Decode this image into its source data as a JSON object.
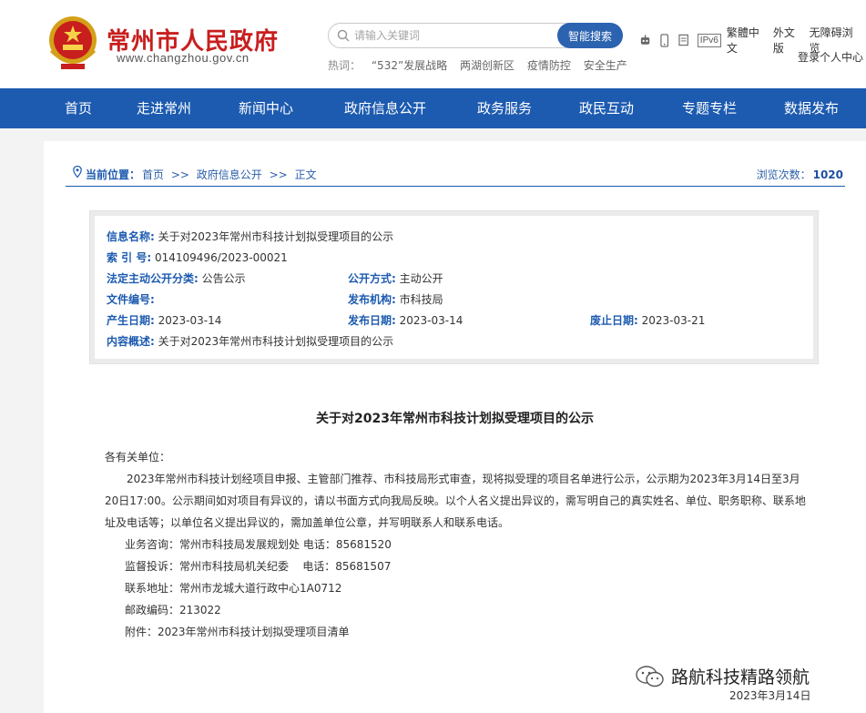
{
  "header": {
    "site_name": "常州市人民政府",
    "site_url": "www.changzhou.gov.cn",
    "search": {
      "placeholder": "请输入关键词",
      "button": "智能搜索"
    },
    "hot_label": "热词：",
    "hot_words": [
      "“532”发展战略",
      "两湖创新区",
      "疫情防控",
      "安全生产"
    ],
    "tools": {
      "ipv6": "IPv6",
      "traditional": "繁體中文",
      "foreign": "外文版",
      "accessible": "无障碍浏览",
      "login": "登录个人中心"
    },
    "icons": {
      "robot": "robot-icon",
      "mobile": "mobile-icon",
      "copy": "document-icon"
    }
  },
  "nav": [
    "首页",
    "走进常州",
    "新闻中心",
    "政府信息公开",
    "政务服务",
    "政民互动",
    "专题专栏",
    "数据发布"
  ],
  "breadcrumb": {
    "label": "当前位置：",
    "items": [
      "首页",
      ">>",
      "政府信息公开",
      ">>",
      "正文"
    ],
    "views_label": "浏览次数：",
    "views": "1020"
  },
  "meta": {
    "info_name_k": "信息名称:",
    "info_name_v": "关于对2023年常州市科技计划拟受理项目的公示",
    "index_k": "索 引 号:",
    "index_v": "014109496/2023-00021",
    "category_k": "法定主动公开分类:",
    "category_v": "公告公示",
    "method_k": "公开方式:",
    "method_v": "主动公开",
    "docno_k": "文件编号:",
    "docno_v": "",
    "publisher_k": "发布机构:",
    "publisher_v": "市科技局",
    "created_k": "产生日期:",
    "created_v": "2023-03-14",
    "released_k": "发布日期:",
    "released_v": "2023-03-14",
    "expire_k": "废止日期:",
    "expire_v": "2023-03-21",
    "summary_k": "内容概述:",
    "summary_v": "关于对2023年常州市科技计划拟受理项目的公示"
  },
  "article": {
    "title": "关于对2023年常州市科技计划拟受理项目的公示",
    "greeting": "各有关单位：",
    "para_line1": "2023年常州市科技计划经项目申报、主管部门推荐、市科技局形式审查，现将拟受理的项目名单进行公示，公示期为2023年3月14日至3月",
    "para_line2": "20日17:00。公示期间如对项目有异议的，请以书面方式向我局反映。以个人名义提出异议的，需写明自己的真实姓名、单位、职务职称、联系地",
    "para_line3": "址及电话等；以单位名义提出异议的，需加盖单位公章，并写明联系人和联系电话。",
    "consult": "业务咨询：常州市科技局发展规划处 电话：85681520",
    "supervise": "监督投诉：常州市科技局机关纪委    电话：85681507",
    "address": "联系地址：常州市龙城大道行政中心1A0712",
    "postcode": "邮政编码：213022",
    "attachment": "附件：2023年常州市科技计划拟受理项目清单",
    "date": "2023年3月14日"
  },
  "watermark": "路航科技精路领航",
  "colors": {
    "brand_red": "#c81e1e",
    "nav_blue": "#1d5bb0",
    "search_btn": "#2b63b0"
  }
}
